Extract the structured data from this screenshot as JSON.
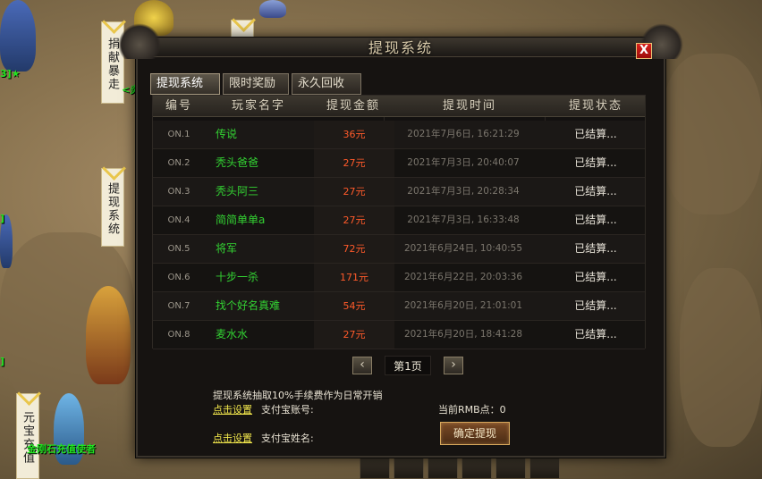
{
  "scene": {
    "banners": [
      {
        "text": "捐献暴走"
      },
      {
        "text": "提现系统"
      },
      {
        "text": "元宝充值"
      }
    ],
    "tags": {
      "a": "3]★",
      "b": "]",
      "c": "]",
      "d": "<炎",
      "e": "金刚石充值使者"
    }
  },
  "window": {
    "title": "提现系统",
    "close_label": "X",
    "tabs": [
      {
        "label": "提现系统"
      },
      {
        "label": "限时奖励"
      },
      {
        "label": "永久回收"
      }
    ]
  },
  "table": {
    "headers": [
      "编号",
      "玩家名字",
      "提现金额",
      "提现时间",
      "提现状态"
    ],
    "rows": [
      {
        "no": "ON.1",
        "name": "传说",
        "amount": "36元",
        "time": "2021年7月6日, 16:21:29",
        "status": "已结算..."
      },
      {
        "no": "ON.2",
        "name": "秃头爸爸",
        "amount": "27元",
        "time": "2021年7月3日, 20:40:07",
        "status": "已结算..."
      },
      {
        "no": "ON.3",
        "name": "秃头阿三",
        "amount": "27元",
        "time": "2021年7月3日, 20:28:34",
        "status": "已结算..."
      },
      {
        "no": "ON.4",
        "name": "简简单单a",
        "amount": "27元",
        "time": "2021年7月3日, 16:33:48",
        "status": "已结算..."
      },
      {
        "no": "ON.5",
        "name": "将军",
        "amount": "72元",
        "time": "2021年6月24日, 10:40:55",
        "status": "已结算..."
      },
      {
        "no": "ON.6",
        "name": "十步一杀",
        "amount": "171元",
        "time": "2021年6月22日, 20:03:36",
        "status": "已结算..."
      },
      {
        "no": "ON.7",
        "name": "找个好名真难",
        "amount": "54元",
        "time": "2021年6月20日, 21:01:01",
        "status": "已结算..."
      },
      {
        "no": "ON.8",
        "name": "麦水水",
        "amount": "27元",
        "time": "2021年6月20日, 18:41:28",
        "status": "已结算..."
      }
    ]
  },
  "pager": {
    "prev": "‹",
    "next": "›",
    "label": "第1页"
  },
  "footer": {
    "notice": "提现系统抽取10%手续费作为日常开销",
    "link1": "点击设置",
    "account_label": "支付宝账号:",
    "rmb_label": "当前RMB点：0",
    "link2": "点击设置",
    "name_label": "支付宝姓名:",
    "submit": "确定提现"
  }
}
